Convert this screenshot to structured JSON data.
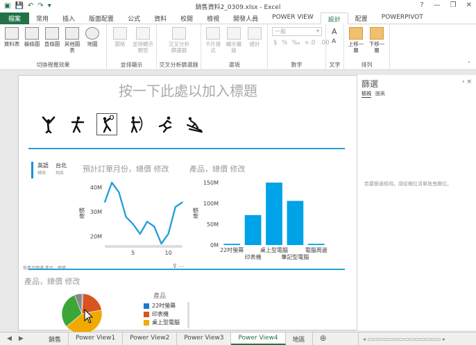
{
  "window": {
    "title": "銷售資料2_0309.xlsx - Excel",
    "controls": [
      "?",
      "—",
      "❐",
      "✕"
    ]
  },
  "ribbon_tabs": [
    "檔案",
    "常用",
    "插入",
    "版面配置",
    "公式",
    "資料",
    "校閱",
    "檢視",
    "開發人員",
    "POWER VIEW",
    "設計",
    "配置",
    "POWERPIVOT"
  ],
  "active_ribbon_tab": "設計",
  "ribbon": {
    "groups": [
      {
        "label": "切換視覺效果",
        "buttons": [
          "資料表",
          "橫條圖",
          "直條圖",
          "其他圖表",
          "地圖"
        ]
      },
      {
        "label": "並排顯示",
        "buttons": [
          "圖格",
          "並排顯示類型"
        ]
      },
      {
        "label": "交叉分析篩選器",
        "buttons": [
          "交叉分析篩選器"
        ]
      },
      {
        "label": "選項",
        "buttons": [
          "卡片樣式",
          "顯示層級",
          "總計"
        ]
      },
      {
        "label": "數字",
        "buttons": [
          "一般",
          "$",
          "%",
          "‰",
          "+.0",
          ".00"
        ]
      },
      {
        "label": "文字",
        "buttons": [
          "A",
          "A"
        ]
      },
      {
        "label": "排列",
        "buttons": [
          "上移一層",
          "下移一層"
        ]
      }
    ]
  },
  "report": {
    "title": "按一下此處以加入標題"
  },
  "tile_strip": {
    "active": {
      "label": "英語",
      "sub": "轉換"
    },
    "second": {
      "label": "台北",
      "sub": "地區"
    }
  },
  "line_chart_title": "預計訂單月份，總價 修改",
  "bar_chart_title": "產品，總價 修改",
  "pie_chart_title": "產品，總價 修改",
  "pie_legend_title": "產品",
  "chart_footer_note": "依產品篩選 產品，總價",
  "filter_pane": {
    "title": "篩選",
    "tabs": [
      "檢視",
      "圖表"
    ],
    "hint": "若要篩選檢視，請從欄位清單拖曳欄位。",
    "controls": "‹  ×"
  },
  "sheet_tabs": [
    "銷售",
    "Power View1",
    "Power View2",
    "Power View3",
    "Power View4",
    "地區"
  ],
  "active_sheet": "Power View4",
  "colors": {
    "accent": "#217346",
    "chart_blue": "#25a0da",
    "bar": "#00a2e8",
    "pie_orange": "#e36c09",
    "pie_red": "#d9541e",
    "pie_green": "#3aa635",
    "pie_blue": "#1f77d0",
    "pie_yellow": "#f2a900"
  },
  "chart_data": [
    {
      "type": "line",
      "title": "預計訂單月份，總價 修改",
      "ylabel": "總價",
      "xlabel": "",
      "x": [
        1,
        2,
        3,
        4,
        5,
        6,
        7,
        8,
        9,
        10,
        11,
        12
      ],
      "values": [
        34,
        42,
        38,
        28,
        25,
        21,
        26,
        24,
        17,
        21,
        32,
        34
      ],
      "ylim": [
        17,
        42
      ],
      "yticks": [
        "20M",
        "30M",
        "40M"
      ],
      "ytick_values": [
        20,
        30,
        40
      ],
      "xticks": [
        "5",
        "10"
      ],
      "xtick_values": [
        5,
        10
      ],
      "unit": "M"
    },
    {
      "type": "bar",
      "title": "產品，總價 修改",
      "ylabel": "總價",
      "categories": [
        "22吋螢幕",
        "印表機",
        "桌上型電腦",
        "筆記型電腦",
        "電腦周邊"
      ],
      "values": [
        3,
        72,
        150,
        106,
        3
      ],
      "ylim": [
        0,
        150
      ],
      "yticks": [
        "0M",
        "50M",
        "100M",
        "150M"
      ],
      "ytick_values": [
        0,
        50,
        100,
        150
      ],
      "unit": "M"
    },
    {
      "type": "pie",
      "title": "產品，總價 修改",
      "legend_title": "產品",
      "categories": [
        "22吋螢幕",
        "印表機",
        "桌上型電腦",
        "筆記型電腦",
        "電腦周邊"
      ],
      "values": [
        1,
        21,
        42,
        30,
        6
      ],
      "colors": [
        "#1f77d0",
        "#d9541e",
        "#f2a900",
        "#3aa635",
        "#888888"
      ],
      "legend_visible": [
        "22吋螢幕",
        "印表機",
        "桌上型電腦"
      ]
    }
  ]
}
